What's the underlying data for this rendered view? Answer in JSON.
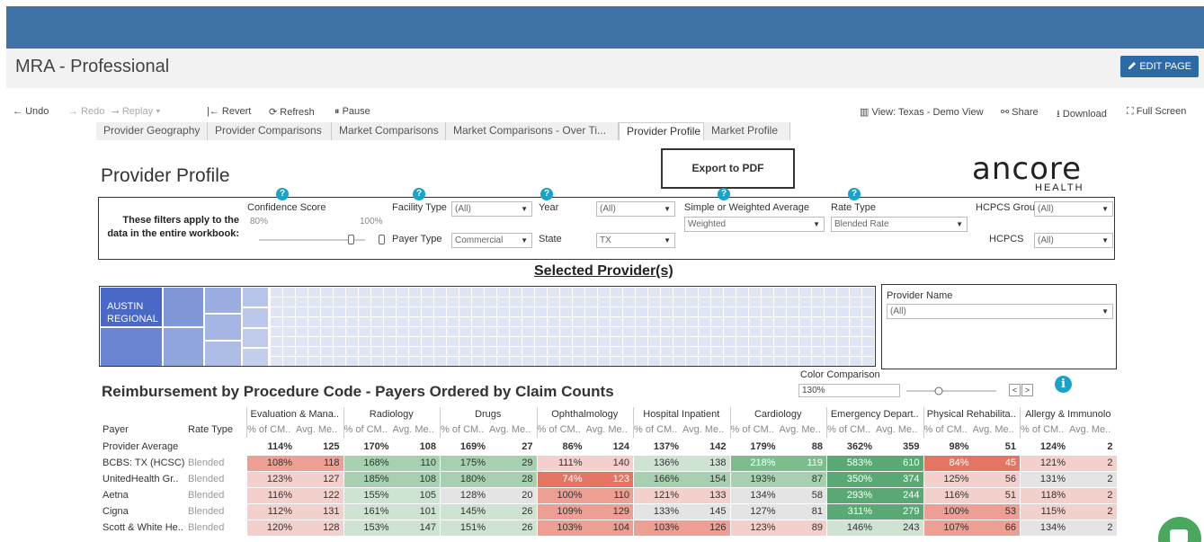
{
  "page": {
    "title": "MRA - Professional",
    "edit_label": "EDIT PAGE"
  },
  "toolbar": {
    "undo": "Undo",
    "redo": "Redo",
    "replay": "Replay",
    "revert": "Revert",
    "refresh": "Refresh",
    "pause": "Pause",
    "view": "View: Texas - Demo View",
    "share": "Share",
    "download": "Download",
    "fullscreen": "Full Screen"
  },
  "tabs": [
    "Provider Geography",
    "Provider Comparisons",
    "Market Comparisons",
    "Market Comparisons - Over Ti...",
    "Provider Profile",
    "Market Profile"
  ],
  "active_tab": "Provider Profile",
  "dashboard": {
    "heading": "Provider Profile",
    "export_label": "Export to PDF",
    "logo_text": "ancore",
    "logo_sub": "HEALTH",
    "filters_note": "These filters apply to the data in the entire workbook:",
    "confidence": {
      "label": "Confidence Score",
      "min": "80%",
      "max": "100%",
      "value": 1.0
    },
    "facility_type": {
      "label": "Facility Type",
      "value": "(All)"
    },
    "payer_type": {
      "label": "Payer Type",
      "value": "Commercial"
    },
    "year": {
      "label": "Year",
      "value": "(All)"
    },
    "state": {
      "label": "State",
      "value": "TX"
    },
    "simple_weighted": {
      "label": "Simple or Weighted Average",
      "value": "Weighted"
    },
    "rate_type": {
      "label": "Rate Type",
      "value": "Blended Rate"
    },
    "hcpcs_group": {
      "label": "HCPCS Group",
      "value": "(All)"
    },
    "hcpcs": {
      "label": "HCPCS",
      "value": "(All)"
    },
    "selected_heading": "Selected Provider(s)",
    "treemap_label": "AUSTIN REGIONAL",
    "provider_name": {
      "label": "Provider Name",
      "value": "(All)"
    },
    "color_comparison": {
      "label": "Color Comparison",
      "value": "130%",
      "slider": 0.3
    },
    "reimb_title": "Reimbursement by Procedure Code - Payers Ordered by Claim Counts"
  },
  "table": {
    "payer_header": "Payer",
    "ratetype_header": "Rate Type",
    "sub_pct": "% of CM..",
    "sub_avg": "Avg. Me..",
    "categories": [
      "Evaluation & Mana..",
      "Radiology",
      "Drugs",
      "Ophthalmology",
      "Hospital Inpatient",
      "Cardiology",
      "Emergency Depart..",
      "Physical Rehabilita..",
      "Allergy & Immunolo"
    ],
    "rows": [
      {
        "payer": "Provider Average",
        "rate": "",
        "bold": true,
        "cells": [
          [
            "114%",
            "125"
          ],
          [
            "170%",
            "108"
          ],
          [
            "169%",
            "27"
          ],
          [
            "86%",
            "124"
          ],
          [
            "137%",
            "142"
          ],
          [
            "179%",
            "88"
          ],
          [
            "362%",
            "359"
          ],
          [
            "98%",
            "51"
          ],
          [
            "124%",
            "2"
          ]
        ]
      },
      {
        "payer": "BCBS: TX (HCSC)",
        "rate": "Blended",
        "cells": [
          [
            "108%",
            "118"
          ],
          [
            "168%",
            "110"
          ],
          [
            "175%",
            "29"
          ],
          [
            "111%",
            "140"
          ],
          [
            "136%",
            "138"
          ],
          [
            "218%",
            "119"
          ],
          [
            "583%",
            "610"
          ],
          [
            "84%",
            "45"
          ],
          [
            "121%",
            "2"
          ]
        ]
      },
      {
        "payer": "UnitedHealth Gr..",
        "rate": "Blended",
        "cells": [
          [
            "123%",
            "127"
          ],
          [
            "185%",
            "108"
          ],
          [
            "180%",
            "28"
          ],
          [
            "74%",
            "123"
          ],
          [
            "166%",
            "154"
          ],
          [
            "193%",
            "87"
          ],
          [
            "350%",
            "374"
          ],
          [
            "125%",
            "56"
          ],
          [
            "131%",
            "2"
          ]
        ]
      },
      {
        "payer": "Aetna",
        "rate": "Blended",
        "cells": [
          [
            "116%",
            "122"
          ],
          [
            "155%",
            "105"
          ],
          [
            "128%",
            "20"
          ],
          [
            "100%",
            "110"
          ],
          [
            "121%",
            "133"
          ],
          [
            "134%",
            "58"
          ],
          [
            "293%",
            "244"
          ],
          [
            "116%",
            "51"
          ],
          [
            "118%",
            "2"
          ]
        ]
      },
      {
        "payer": "Cigna",
        "rate": "Blended",
        "cells": [
          [
            "112%",
            "131"
          ],
          [
            "161%",
            "101"
          ],
          [
            "145%",
            "26"
          ],
          [
            "109%",
            "129"
          ],
          [
            "133%",
            "145"
          ],
          [
            "127%",
            "81"
          ],
          [
            "311%",
            "279"
          ],
          [
            "100%",
            "53"
          ],
          [
            "115%",
            "2"
          ]
        ]
      },
      {
        "payer": "Scott & White He..",
        "rate": "Blended",
        "cells": [
          [
            "120%",
            "128"
          ],
          [
            "153%",
            "147"
          ],
          [
            "151%",
            "26"
          ],
          [
            "103%",
            "104"
          ],
          [
            "103%",
            "126"
          ],
          [
            "123%",
            "89"
          ],
          [
            "146%",
            "243"
          ],
          [
            "107%",
            "66"
          ],
          [
            "134%",
            "2"
          ]
        ]
      }
    ]
  }
}
